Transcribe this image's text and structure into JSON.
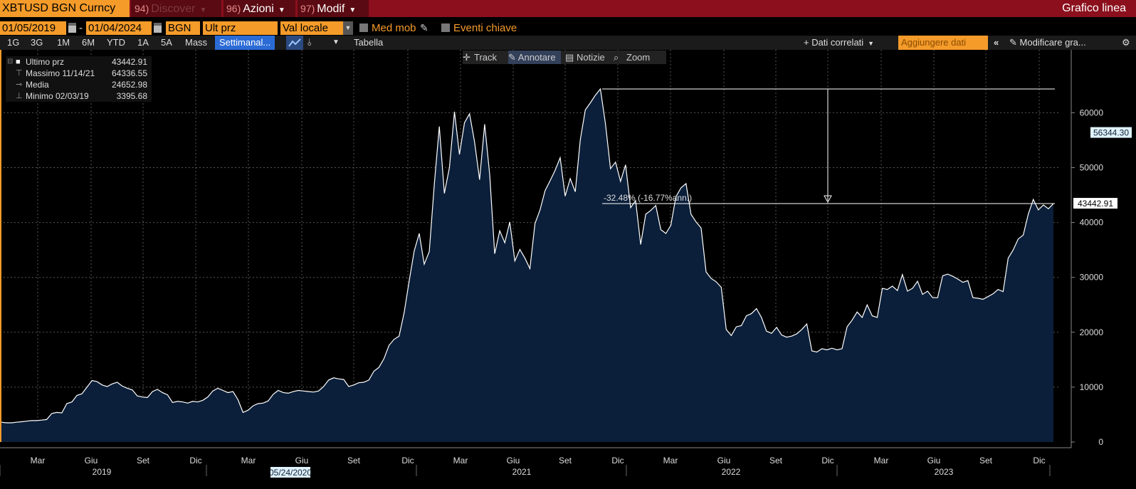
{
  "topbar": {
    "security": "XBTUSD BGN Curncy",
    "discover_num": "94)",
    "discover": "Discover",
    "azioni_num": "96)",
    "azioni": "Azioni",
    "modif_num": "97)",
    "modif": "Modif",
    "chart_type": "Grafico linea"
  },
  "controls": {
    "start_date": "01/05/2019",
    "dash": "-",
    "end_date": "01/04/2024",
    "source": "BGN",
    "field": "Ult prz",
    "currency": "Val locale",
    "med_mob": "Med mob",
    "eventi": "Eventi chiave"
  },
  "periods": [
    "1G",
    "3G",
    "1M",
    "6M",
    "YTD",
    "1A",
    "5A",
    "Mass"
  ],
  "toolbar": {
    "frequency": "Settimanal...",
    "tabella": "Tabella",
    "dati_correlati": "+ Dati correlati",
    "aggiungere": "Aggiungere dati",
    "modificare": "Modificare gra..."
  },
  "chart_tools": [
    "Track",
    "Annotare",
    "Notizie",
    "Zoom"
  ],
  "legend": [
    {
      "label": "Ultimo prz",
      "value": "43442.91"
    },
    {
      "label": "Massimo 11/14/21",
      "value": "64336.55"
    },
    {
      "label": "Media",
      "value": "24652.98"
    },
    {
      "label": "Minimo 02/03/19",
      "value": "3395.68"
    }
  ],
  "annotation": "-32.48% (-16.77%ann.)",
  "cursor_date": "05/24/2020",
  "badges": {
    "upper": "56344.30",
    "last": "43442.91"
  },
  "colors": {
    "accent": "#f49b2a",
    "topbar": "#8b0f1c",
    "fill": "#0b1f3a",
    "line": "#ffffff"
  },
  "chart_data": {
    "type": "area",
    "series": [
      {
        "values": [
          3600,
          3500,
          3500,
          3600,
          3700,
          3800,
          3900,
          3900,
          4000,
          4100,
          5200,
          5400,
          5300,
          7000,
          7300,
          8500,
          8800,
          10000,
          11200,
          11000,
          10400,
          10100,
          10600,
          10900,
          10200,
          9800,
          9500,
          8400,
          8200,
          8100,
          9200,
          9600,
          9000,
          8600,
          7200,
          7400,
          7300,
          7100,
          7400,
          7300,
          7600,
          8200,
          9300,
          9800,
          9400,
          9000,
          9200,
          7700,
          5400,
          5800,
          6600,
          7000,
          7100,
          7500,
          8700,
          9400,
          9000,
          8900,
          9200,
          9400,
          9300,
          9200,
          9100,
          9300,
          10100,
          11300,
          11700,
          11500,
          11400,
          10100,
          10400,
          10800,
          10900,
          11300,
          12900,
          13600,
          15200,
          17600,
          18700,
          19300,
          23500,
          29300,
          34800,
          38000,
          32400,
          34700,
          47000,
          57500,
          45300,
          50000,
          60200,
          52400,
          58200,
          59800,
          54700,
          47800,
          57900,
          48700,
          34300,
          38500,
          36300,
          40100,
          33000,
          35100,
          33500,
          31600,
          39800,
          42300,
          45800,
          47600,
          49500,
          51800,
          44800,
          48000,
          45600,
          55100,
          60500,
          61800,
          63200,
          64336,
          58000,
          49800,
          51000,
          47500,
          50500,
          42700,
          44000,
          36000,
          41500,
          42200,
          43100,
          38700,
          38000,
          39500,
          44700,
          46300,
          47100,
          41500,
          40100,
          39000,
          31000,
          29800,
          29200,
          28200,
          20500,
          19400,
          21000,
          21200,
          23000,
          23400,
          24300,
          22700,
          20200,
          19800,
          20900,
          19500,
          19100,
          19300,
          19700,
          20500,
          21500,
          16600,
          16400,
          17000,
          16800,
          17100,
          16800,
          17000,
          21000,
          22200,
          23700,
          22700,
          25000,
          23000,
          22700,
          28000,
          27800,
          28400,
          27600,
          30500,
          27500,
          28000,
          29300,
          26900,
          27500,
          26300,
          26300,
          30300,
          30600,
          30200,
          29700,
          29100,
          29400,
          26300,
          26200,
          26000,
          26500,
          27000,
          27800,
          27400,
          33500,
          35000,
          37000,
          37700,
          41500,
          44200,
          42300,
          43200,
          42500,
          43442
        ]
      }
    ],
    "x_labels": [
      "Mar",
      "Giu",
      "Set",
      "Dic",
      "Mar",
      "Giu",
      "Set",
      "Dic",
      "Mar",
      "Giu",
      "Set",
      "Dic",
      "Mar",
      "Giu",
      "Set",
      "Dic",
      "Mar",
      "Giu",
      "Set",
      "Dic"
    ],
    "year_labels": [
      "2019",
      "2020",
      "2021",
      "2022",
      "2023"
    ],
    "y_ticks": [
      0,
      10000,
      20000,
      30000,
      40000,
      50000,
      60000
    ],
    "ylim": [
      0,
      65500
    ],
    "grid": true
  }
}
